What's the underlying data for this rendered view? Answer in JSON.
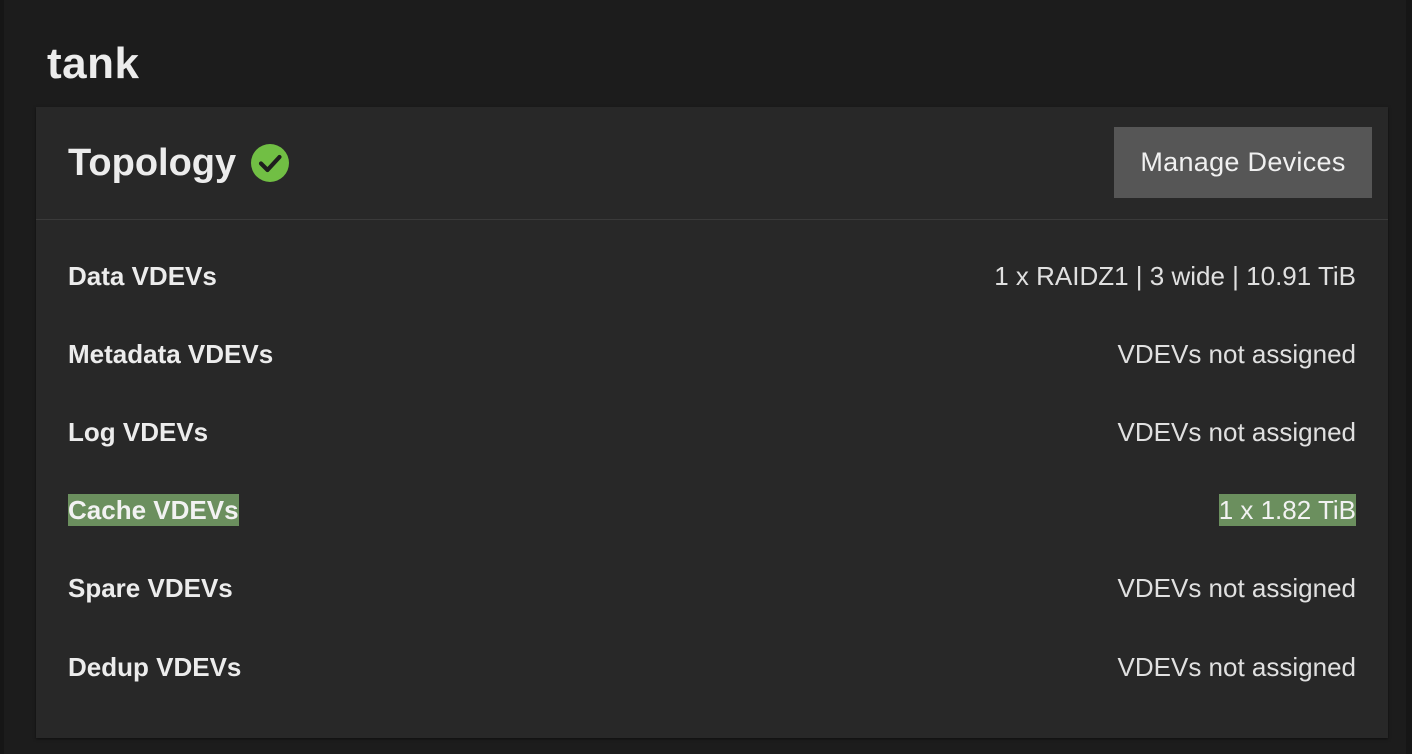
{
  "pool": {
    "name": "tank"
  },
  "topology": {
    "title": "Topology",
    "status_icon": "check-circle-icon",
    "status_color": "#71bf44",
    "manage_label": "Manage Devices",
    "highlight_color": "#6b8f5e",
    "rows": [
      {
        "label": "Data VDEVs",
        "value": "1 x RAIDZ1 | 3 wide | 10.91 TiB"
      },
      {
        "label": "Metadata VDEVs",
        "value": "VDEVs not assigned"
      },
      {
        "label": "Log VDEVs",
        "value": "VDEVs not assigned"
      },
      {
        "label": "Cache VDEVs",
        "value": "1 x 1.82 TiB",
        "highlighted": true
      },
      {
        "label": "Spare VDEVs",
        "value": "VDEVs not assigned"
      },
      {
        "label": "Dedup VDEVs",
        "value": "VDEVs not assigned"
      }
    ]
  }
}
